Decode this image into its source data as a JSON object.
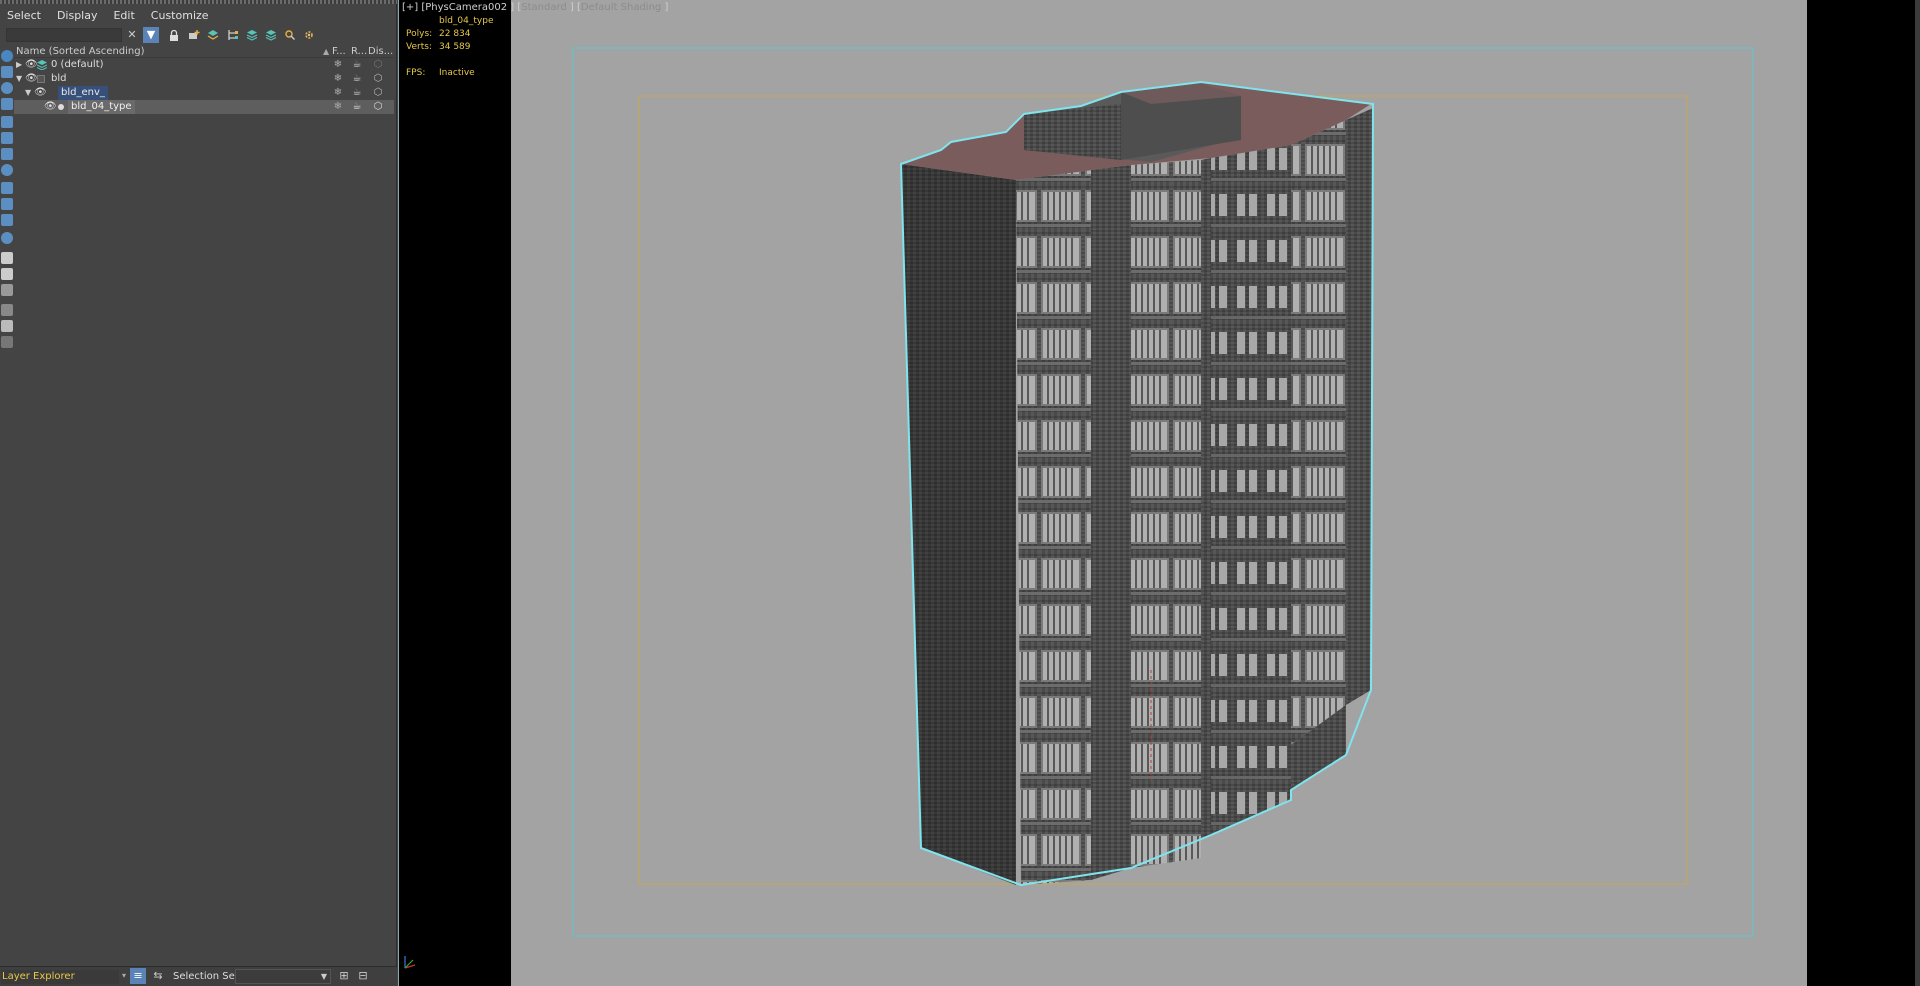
{
  "explorer": {
    "menu": [
      "Select",
      "Display",
      "Edit",
      "Customize"
    ],
    "column_headers": {
      "name": "Name (Sorted Ascending)",
      "frozen": "F...",
      "render": "R...",
      "display": "Dis..."
    },
    "rows": [
      {
        "label": "0 (default)"
      },
      {
        "label": "bld"
      },
      {
        "label": "bld_env_"
      },
      {
        "label": "bld_04_type"
      }
    ],
    "bottom": {
      "explorer_name": "Layer Explorer",
      "selection_set_label": "Selection Set:",
      "selection_set_value": ""
    },
    "toolbar_icons": [
      "close-icon",
      "filter-icon",
      "lock-icon",
      "add-layer-icon",
      "layers-icon",
      "hierarchy-icon",
      "layer-stack-icon",
      "layer-stack-2-icon",
      "find-icon",
      "settings-icon"
    ]
  },
  "viewport": {
    "label_part1": "[+] [PhysCamera002 ] [",
    "label_part2": "Standard",
    "label_part3": " ] [",
    "label_part4": "Default Shading",
    "label_part5": " ]",
    "object_name": "bld_04_type",
    "polys_label": "Polys:",
    "polys_value": "22 834",
    "verts_label": "Verts:",
    "verts_value": "34 589",
    "fps_label": "FPS:",
    "fps_value": "Inactive"
  },
  "colors": {
    "selection_outline": "#7fe4ee",
    "safe_frame_outer": "#5fc7cf",
    "safe_frame_inner": "#c9a552",
    "stats_text": "#e6c84a",
    "viewport_bg": "#a3a3a3"
  }
}
